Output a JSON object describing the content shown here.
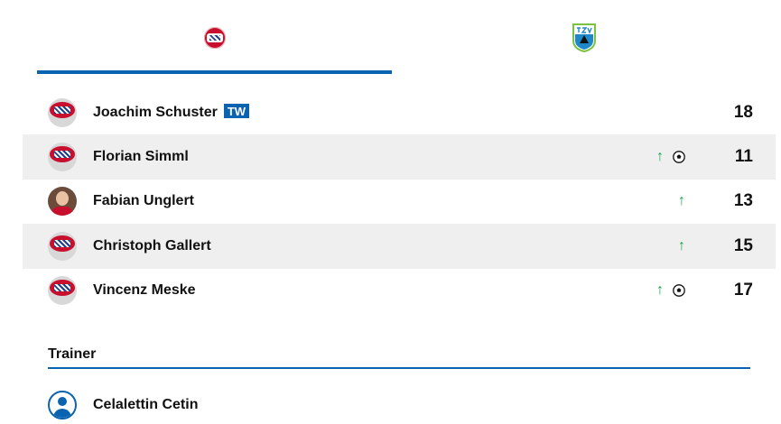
{
  "tabs": [
    {
      "crest": "fc-bayern-crest-icon",
      "selected": true
    },
    {
      "crest": "tsv-crest-icon",
      "selected": false
    }
  ],
  "players": [
    {
      "name": "Joachim Schuster",
      "badge": "TW",
      "number": "18",
      "sub_in": false,
      "goal": false,
      "avatar": "crest"
    },
    {
      "name": "Florian Simml",
      "badge": "",
      "number": "11",
      "sub_in": true,
      "goal": true,
      "avatar": "crest"
    },
    {
      "name": "Fabian Unglert",
      "badge": "",
      "number": "13",
      "sub_in": true,
      "goal": false,
      "avatar": "photo"
    },
    {
      "name": "Christoph Gallert",
      "badge": "",
      "number": "15",
      "sub_in": true,
      "goal": false,
      "avatar": "crest"
    },
    {
      "name": "Vincenz Meske",
      "badge": "",
      "number": "17",
      "sub_in": true,
      "goal": true,
      "avatar": "crest"
    }
  ],
  "trainer": {
    "title": "Trainer",
    "name": "Celalettin Cetin"
  },
  "colors": {
    "accent": "#0a63b0",
    "sub_in": "#17a34a",
    "alt_row": "#efefef"
  }
}
